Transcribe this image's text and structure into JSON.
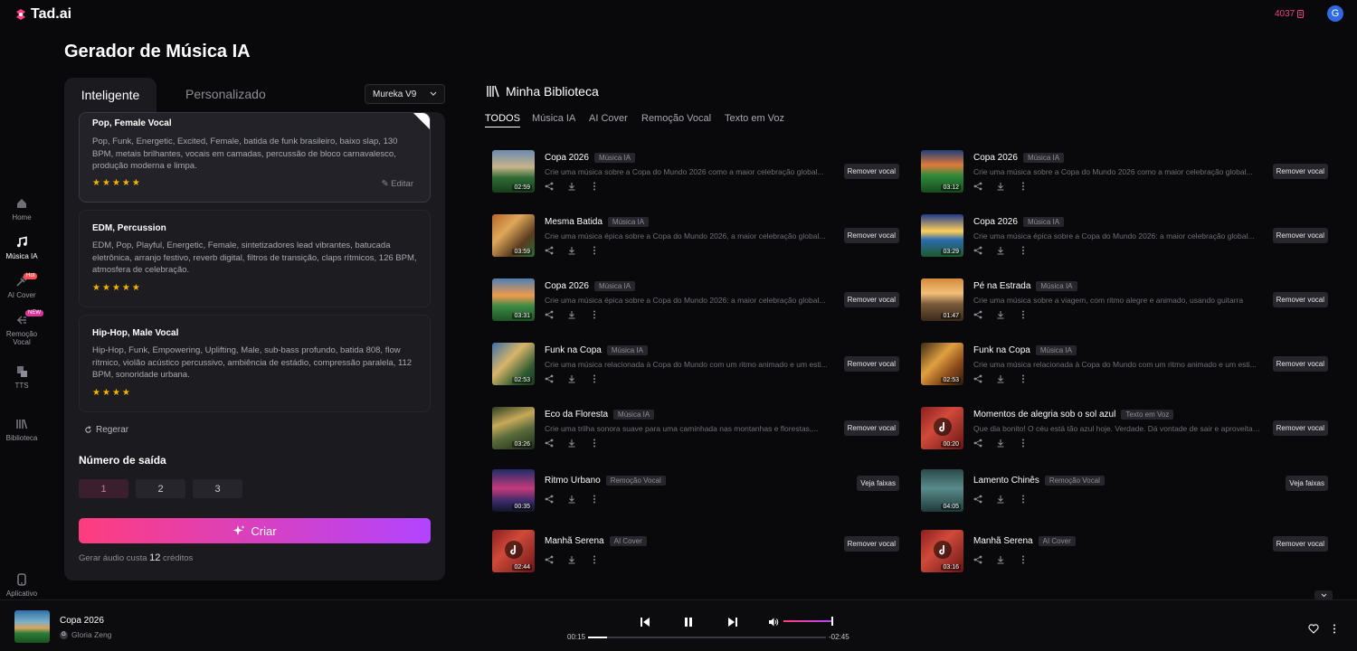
{
  "app": {
    "name": "Tad.ai",
    "credits": "4037",
    "avatar": "G"
  },
  "nav": [
    {
      "label": "Home",
      "icon": "home-icon"
    },
    {
      "label": "Música IA",
      "icon": "music-notes-icon",
      "active": true
    },
    {
      "label": "AI Cover",
      "icon": "cover-icon",
      "badge": "Hot"
    },
    {
      "label": "Remoção Vocal",
      "icon": "vocal-split-icon",
      "badge": "NEW"
    },
    {
      "label": "TTS",
      "icon": "tts-icon"
    },
    {
      "label": "Biblioteca",
      "icon": "library-icon"
    }
  ],
  "nav_app": "Aplicativo",
  "page_title": "Gerador de Música IA",
  "generator": {
    "tab_smart": "Inteligente",
    "tab_custom": "Personalizado",
    "model": "Mureka V9",
    "presets": [
      {
        "title": "Pop, Female Vocal",
        "desc": "Pop, Funk, Energetic, Excited, Female, batida de funk brasileiro, baixo slap, 130 BPM, metais brilhantes, vocais em camadas, percussão de bloco carnavalesco, produção moderna e limpa.",
        "rating": 5,
        "edit": "Editar"
      },
      {
        "title": "EDM, Percussion",
        "desc": "EDM, Pop, Playful, Energetic, Female, sintetizadores lead vibrantes, batucada eletrônica, arranjo festivo, reverb digital, filtros de transição, claps rítmicos, 126 BPM, atmosfera de celebração.",
        "rating": 5
      },
      {
        "title": "Hip-Hop, Male Vocal",
        "desc": "Hip-Hop, Funk, Empowering, Uplifting, Male, sub-bass profundo, batida 808, flow rítmico, violão acústico percussivo, ambiência de estádio, compressão paralela, 112 BPM, sonoridade urbana.",
        "rating": 4
      }
    ],
    "regen": "Regerar",
    "output_label": "Número de saída",
    "output_options": [
      "1",
      "2",
      "3"
    ],
    "create": "Criar",
    "cost_prefix": "Gerar áudio custa",
    "cost_value": "12",
    "cost_suffix": "créditos"
  },
  "library": {
    "title": "Minha Biblioteca",
    "tabs": [
      "TODOS",
      "Música IA",
      "AI Cover",
      "Remoção Vocal",
      "Texto em Voz"
    ],
    "songs_left": [
      {
        "title": "Copa 2026",
        "tag": "Música IA",
        "desc": "Crie uma música sobre a Copa do Mundo 2026 como a maior celebração global...",
        "dur": "02:59",
        "btn": "Remover vocal"
      },
      {
        "title": "Mesma Batida",
        "tag": "Música IA",
        "desc": "Crie uma música épica sobre a Copa do Mundo 2026, a maior celebração global...",
        "dur": "03:59",
        "btn": "Remover vocal"
      },
      {
        "title": "Copa 2026",
        "tag": "Música IA",
        "desc": "Crie uma música épica sobre a Copa do Mundo 2026: a maior celebração global...",
        "dur": "03:31",
        "btn": "Remover vocal"
      },
      {
        "title": "Funk na Copa",
        "tag": "Música IA",
        "desc": "Crie uma música relacionada à Copa do Mundo com um ritmo animado e um esti...",
        "dur": "02:53",
        "btn": "Remover vocal"
      },
      {
        "title": "Eco da Floresta",
        "tag": "Música IA",
        "desc": "Crie uma trilha sonora suave para uma caminhada nas montanhas e florestas,...",
        "dur": "03:26",
        "btn": "Remover vocal"
      },
      {
        "title": "Ritmo Urbano",
        "tag": "Remoção Vocal",
        "desc": "",
        "dur": "00:35",
        "btn": "Veja faixas"
      },
      {
        "title": "Manhã Serena",
        "tag": "AI Cover",
        "desc": "",
        "dur": "02:44",
        "btn": "Remover vocal"
      }
    ],
    "songs_right": [
      {
        "title": "Copa 2026",
        "tag": "Música IA",
        "desc": "Crie uma música sobre a Copa do Mundo 2026 como a maior celebração global...",
        "dur": "03:12",
        "btn": "Remover vocal"
      },
      {
        "title": "Copa 2026",
        "tag": "Música IA",
        "desc": "Crie uma música épica sobre a Copa do Mundo 2026: a maior celebração global...",
        "dur": "03:29",
        "btn": "Remover vocal"
      },
      {
        "title": "Pé na Estrada",
        "tag": "Música IA",
        "desc": "Crie uma música sobre a viagem, com ritmo alegre e animado, usando guitarra",
        "dur": "01:47",
        "btn": "Remover vocal"
      },
      {
        "title": "Funk na Copa",
        "tag": "Música IA",
        "desc": "Crie uma música relacionada à Copa do Mundo com um ritmo animado e um esti...",
        "dur": "02:53",
        "btn": "Remover vocal"
      },
      {
        "title": "Momentos de alegria sob o sol azul",
        "tag": "Texto em Voz",
        "desc": "Que dia bonito! O céu está tão azul hoje. Verdade. Dá vontade de sair e aproveitar o sol. Às veze...",
        "dur": "00:20",
        "btn": "Remover vocal"
      },
      {
        "title": "Lamento Chinês",
        "tag": "Remoção Vocal",
        "desc": "",
        "dur": "04:05",
        "btn": "Veja faixas"
      },
      {
        "title": "Manhã Serena",
        "tag": "AI Cover",
        "desc": "",
        "dur": "03:16",
        "btn": "Remover vocal"
      }
    ]
  },
  "player": {
    "title": "Copa 2026",
    "artist": "Gloria Zeng",
    "artist_initial": "G",
    "time_current": "00:15",
    "time_remaining": "-02:45",
    "progress": 0.08,
    "volume": 1.0
  },
  "colors": {
    "accent_pink": "#ff3d7f",
    "accent_purple": "#b244ff",
    "star": "#f4b400",
    "credits": "#ec3f8c"
  }
}
